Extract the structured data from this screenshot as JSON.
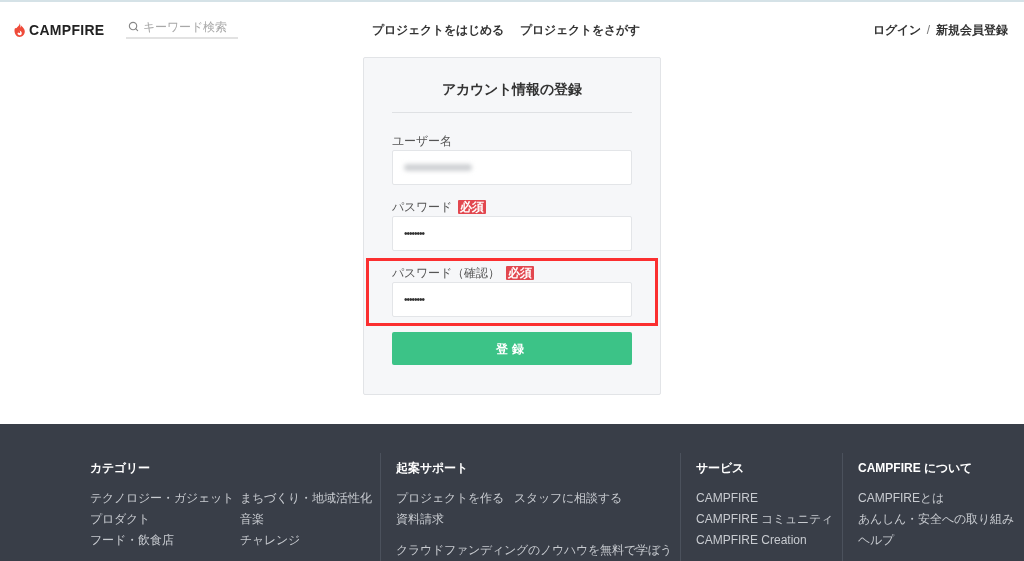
{
  "header": {
    "logo": "CAMPFIRE",
    "search": {
      "placeholder": "キーワード検索"
    },
    "nav": [
      "プロジェクトをはじめる",
      "プロジェクトをさがす"
    ],
    "auth": {
      "login": "ログイン",
      "separator": "/",
      "signup": "新規会員登録"
    }
  },
  "form": {
    "title": "アカウント情報の登録",
    "fields": [
      {
        "kind": "redacted",
        "label": "ユーザー名",
        "highlighted": false
      },
      {
        "kind": "password",
        "label": "パスワード",
        "badge": "必須",
        "value": "••••••••",
        "highlighted": false
      },
      {
        "kind": "password",
        "label": "パスワード（確認）",
        "badge": "必須",
        "value": "••••••••",
        "highlighted": true
      }
    ],
    "submit": "登録"
  },
  "footer": {
    "columns": [
      {
        "heading": "カテゴリー",
        "rows": [
          [
            "テクノロジー・ガジェット",
            "まちづくり・地域活性化"
          ],
          [
            "プロダクト",
            "音楽"
          ],
          [
            "フード・飲食店",
            "チャレンジ"
          ]
        ]
      },
      {
        "heading": "起案サポート",
        "rows": [
          [
            "プロジェクトを作る",
            "スタッフに相談する"
          ],
          [
            "資料請求"
          ]
        ],
        "wide_links": [
          "クラウドファンディングのノウハウを無料で学ぼう"
        ]
      },
      {
        "heading": "サービス",
        "rows": [
          [
            "CAMPFIRE"
          ],
          [
            "CAMPFIRE コミュニティ"
          ],
          [
            "CAMPFIRE Creation"
          ]
        ]
      },
      {
        "heading": "CAMPFIRE について",
        "rows": [
          [
            "CAMPFIREとは"
          ],
          [
            "あんしん・安全への取り組み"
          ],
          [
            "ヘルプ"
          ]
        ]
      }
    ]
  }
}
